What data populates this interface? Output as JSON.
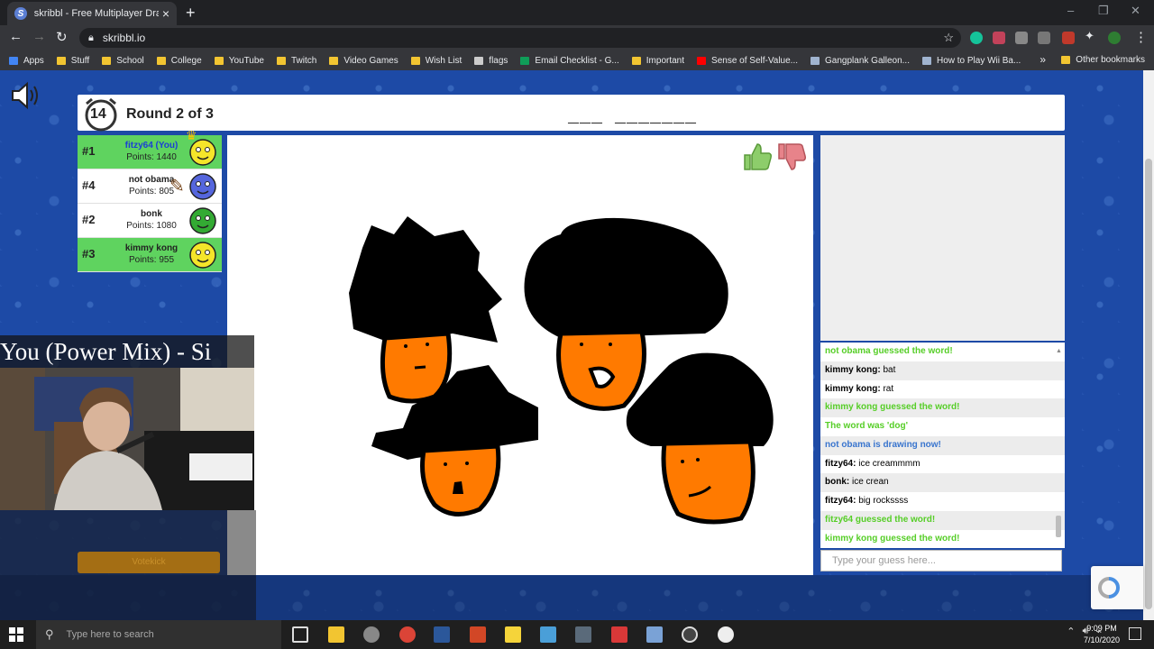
{
  "browser": {
    "tab_title": "skribbl - Free Multiplayer Drawing",
    "url": "skribbl.io",
    "bookmarks": [
      {
        "label": "Apps",
        "icon": "apps-grid-icon"
      },
      {
        "label": "Stuff",
        "icon": "folder-icon"
      },
      {
        "label": "School",
        "icon": "folder-icon"
      },
      {
        "label": "College",
        "icon": "folder-icon"
      },
      {
        "label": "YouTube",
        "icon": "folder-icon"
      },
      {
        "label": "Twitch",
        "icon": "folder-icon"
      },
      {
        "label": "Video Games",
        "icon": "folder-icon"
      },
      {
        "label": "Wish List",
        "icon": "folder-icon"
      },
      {
        "label": "flags",
        "icon": "flask-icon"
      },
      {
        "label": "Email Checklist - G...",
        "icon": "sheets-icon"
      },
      {
        "label": "Important",
        "icon": "folder-icon"
      },
      {
        "label": "Sense of Self-Value...",
        "icon": "youtube-icon"
      },
      {
        "label": "Gangplank Galleon...",
        "icon": "site-icon"
      },
      {
        "label": "How to Play Wii Ba...",
        "icon": "site-icon"
      }
    ],
    "other_bookmarks": "Other bookmarks"
  },
  "game": {
    "timer": "14",
    "round_label": "Round 2 of 3",
    "word_hint": "___ _______",
    "players": [
      {
        "rank": "#1",
        "name": "fitzy64 (You)",
        "points": "Points: 1440",
        "guessed": true,
        "is_you": true,
        "avatar_color": "#f5e52a"
      },
      {
        "rank": "#4",
        "name": "not obama",
        "points": "Points: 805",
        "guessed": false,
        "is_you": false,
        "avatar_color": "#5566dd"
      },
      {
        "rank": "#2",
        "name": "bonk",
        "points": "Points: 1080",
        "guessed": false,
        "is_you": false,
        "avatar_color": "#33aa33"
      },
      {
        "rank": "#3",
        "name": "kimmy kong",
        "points": "Points: 955",
        "guessed": true,
        "is_you": false,
        "avatar_color": "#f5e52a"
      }
    ],
    "votekick_label": "Votekick"
  },
  "chat": {
    "messages": [
      {
        "author": "",
        "text": "not obama guessed the word!",
        "style": "green"
      },
      {
        "author": "kimmy kong:",
        "text": "bat",
        "style": "normal"
      },
      {
        "author": "kimmy kong:",
        "text": "rat",
        "style": "normal"
      },
      {
        "author": "",
        "text": "kimmy kong guessed the word!",
        "style": "green"
      },
      {
        "author": "",
        "text": "The word was 'dog'",
        "style": "green"
      },
      {
        "author": "",
        "text": "not obama is drawing now!",
        "style": "blue"
      },
      {
        "author": "fitzy64:",
        "text": "ice creammmm",
        "style": "normal"
      },
      {
        "author": "bonk:",
        "text": "ice crean",
        "style": "normal"
      },
      {
        "author": "fitzy64:",
        "text": "big rockssss",
        "style": "normal"
      },
      {
        "author": "",
        "text": "fitzy64 guessed the word!",
        "style": "green"
      },
      {
        "author": "",
        "text": "kimmy kong guessed the word!",
        "style": "green"
      }
    ],
    "input_placeholder": "Type your guess here..."
  },
  "overlay": {
    "music_title": "You (Power Mix) - Si"
  },
  "taskbar": {
    "search_placeholder": "Type here to search",
    "time": "9:09 PM",
    "date": "7/10/2020"
  },
  "colors": {
    "guessed_green": "#5fd35f",
    "chat_green": "#56ce27",
    "chat_blue": "#3975ce",
    "page_blue": "#1d4aa6"
  }
}
